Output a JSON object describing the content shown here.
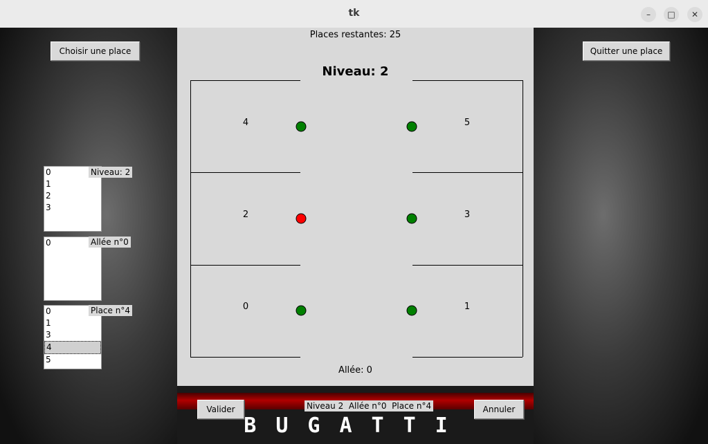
{
  "window": {
    "title": "tk",
    "minimize_glyph": "–",
    "maximize_glyph": "□",
    "close_glyph": "✕"
  },
  "left": {
    "choose_button": "Choisir une place",
    "niveau_list": [
      "0",
      "1",
      "2",
      "3"
    ],
    "niveau_label": "Niveau: 2",
    "allee_list": [
      "0"
    ],
    "allee_label": "Allée n°0",
    "place_list": [
      "0",
      "1",
      "3",
      "4",
      "5"
    ],
    "place_selected": "4",
    "place_label": "Place n°4"
  },
  "right": {
    "quit_button": "Quitter une place"
  },
  "center": {
    "remaining": "Places restantes: 25",
    "level_title": "Niveau: 2",
    "allee_label": "Allée: 0",
    "spots": [
      {
        "number": "4",
        "status": "free"
      },
      {
        "number": "5",
        "status": "free"
      },
      {
        "number": "2",
        "status": "occupied"
      },
      {
        "number": "3",
        "status": "free"
      },
      {
        "number": "0",
        "status": "free"
      },
      {
        "number": "1",
        "status": "free"
      }
    ],
    "colors": {
      "free": "#008000",
      "occupied": "#ff0000"
    }
  },
  "bottom": {
    "validate_button": "Valider",
    "info": "Niveau 2  Allée n°0  Place n°4",
    "cancel_button": "Annuler",
    "brand": "BUGATTI"
  }
}
